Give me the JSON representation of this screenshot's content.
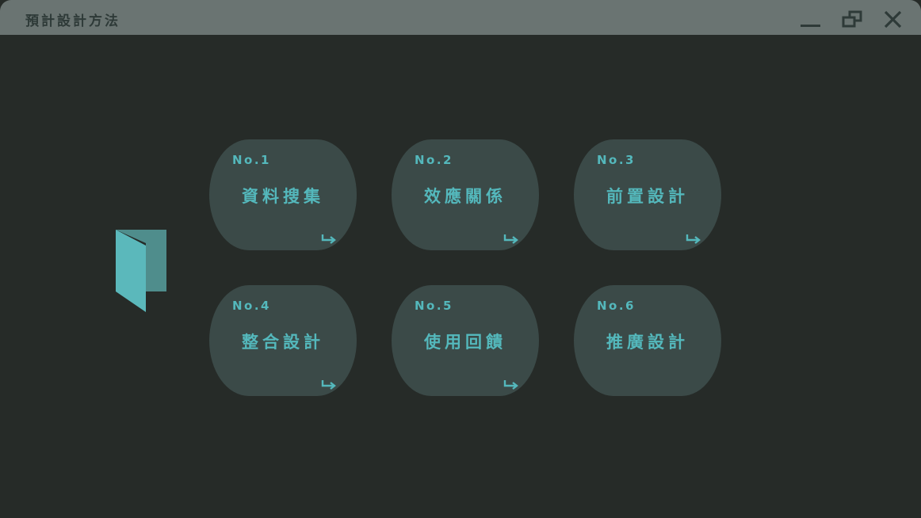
{
  "window": {
    "title": "預計設計方法",
    "controls": {
      "minimize": "minimize-icon",
      "restore": "restore-icon",
      "close": "close-icon"
    }
  },
  "colors": {
    "background": "#262b28",
    "titlebar": "#6a7472",
    "card": "#3b4a48",
    "accent": "#54b8bc",
    "logo_back": "#4f8d8c"
  },
  "cards": [
    {
      "number": "No.1",
      "title": "資料搜集",
      "has_arrow": true
    },
    {
      "number": "No.2",
      "title": "效應關係",
      "has_arrow": true
    },
    {
      "number": "No.3",
      "title": "前置設計",
      "has_arrow": true
    },
    {
      "number": "No.4",
      "title": "整合設計",
      "has_arrow": true
    },
    {
      "number": "No.5",
      "title": "使用回饋",
      "has_arrow": true
    },
    {
      "number": "No.6",
      "title": "推廣設計",
      "has_arrow": false
    }
  ],
  "icons": {
    "logo": "folded-book-icon",
    "card_arrow": "return-arrow-icon"
  }
}
